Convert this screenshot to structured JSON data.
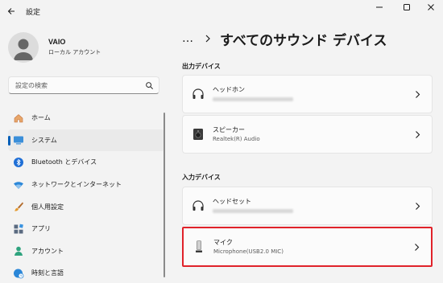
{
  "window": {
    "title": "設定"
  },
  "profile": {
    "name": "VAIO",
    "account_type": "ローカル アカウント"
  },
  "search": {
    "placeholder": "設定の検索"
  },
  "nav": {
    "items": [
      {
        "label": "ホーム",
        "icon": "home-icon"
      },
      {
        "label": "システム",
        "icon": "system-icon",
        "active": true
      },
      {
        "label": "Bluetooth とデバイス",
        "icon": "bluetooth-icon"
      },
      {
        "label": "ネットワークとインターネット",
        "icon": "network-icon"
      },
      {
        "label": "個人用設定",
        "icon": "brush-icon"
      },
      {
        "label": "アプリ",
        "icon": "apps-icon"
      },
      {
        "label": "アカウント",
        "icon": "account-icon"
      },
      {
        "label": "時刻と言語",
        "icon": "globe-clock-icon"
      }
    ]
  },
  "breadcrumb": {
    "more": "…",
    "title": "すべてのサウンド デバイス"
  },
  "output": {
    "heading": "出力デバイス",
    "devices": [
      {
        "name": "ヘッドホン",
        "detail": "",
        "icon": "headphones-icon"
      },
      {
        "name": "スピーカー",
        "detail": "Realtek(R) Audio",
        "icon": "speaker-icon"
      }
    ]
  },
  "input": {
    "heading": "入力デバイス",
    "devices": [
      {
        "name": "ヘッドセット",
        "detail": "",
        "icon": "headset-icon"
      },
      {
        "name": "マイク",
        "detail": "Microphone(USB2.0 MIC)",
        "icon": "microphone-icon"
      }
    ]
  },
  "colors": {
    "accent": "#005fb8",
    "highlight": "#e0222a"
  }
}
